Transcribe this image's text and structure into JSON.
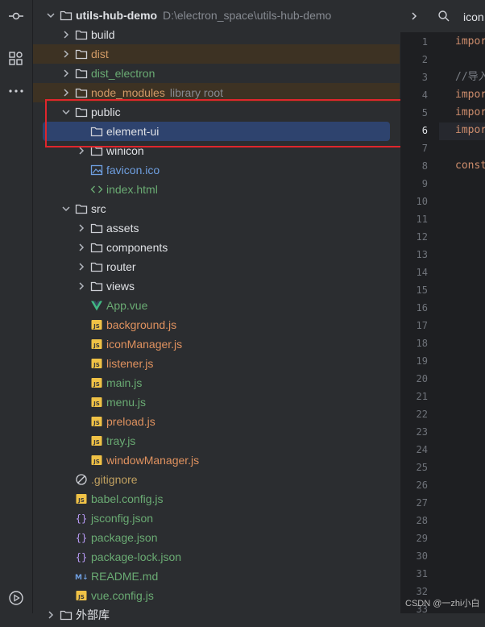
{
  "project": {
    "name": "utils-hub-demo",
    "path": "D:\\electron_space\\utils-hub-demo"
  },
  "tree": [
    {
      "id": "build",
      "label": "build",
      "type": "folder",
      "depth": 1,
      "expanded": false,
      "status": "default"
    },
    {
      "id": "dist",
      "label": "dist",
      "type": "folder",
      "depth": 1,
      "expanded": false,
      "status": "excluded"
    },
    {
      "id": "dist-electron",
      "label": "dist_electron",
      "type": "folder",
      "depth": 1,
      "expanded": false,
      "status": "new"
    },
    {
      "id": "node-modules",
      "label": "node_modules",
      "hint": "library root",
      "type": "folder",
      "depth": 1,
      "expanded": false,
      "status": "excluded"
    },
    {
      "id": "public",
      "label": "public",
      "type": "folder",
      "depth": 1,
      "expanded": true,
      "status": "default"
    },
    {
      "id": "element-ui",
      "label": "element-ui",
      "type": "folder",
      "depth": 2,
      "leaf": true,
      "status": "default",
      "selected": true
    },
    {
      "id": "winicon",
      "label": "winicon",
      "type": "folder",
      "depth": 2,
      "expanded": false,
      "status": "default"
    },
    {
      "id": "favicon",
      "label": "favicon.ico",
      "type": "image",
      "depth": 2,
      "status": "link"
    },
    {
      "id": "index-html",
      "label": "index.html",
      "type": "html",
      "depth": 2,
      "status": "new"
    },
    {
      "id": "src",
      "label": "src",
      "type": "folder",
      "depth": 1,
      "expanded": true,
      "status": "default"
    },
    {
      "id": "assets",
      "label": "assets",
      "type": "folder",
      "depth": 2,
      "expanded": false,
      "status": "default"
    },
    {
      "id": "components",
      "label": "components",
      "type": "folder",
      "depth": 2,
      "expanded": false,
      "status": "default"
    },
    {
      "id": "router",
      "label": "router",
      "type": "folder",
      "depth": 2,
      "expanded": false,
      "status": "default"
    },
    {
      "id": "views",
      "label": "views",
      "type": "folder",
      "depth": 2,
      "expanded": false,
      "status": "default"
    },
    {
      "id": "app-vue",
      "label": "App.vue",
      "type": "vue",
      "depth": 2,
      "status": "new"
    },
    {
      "id": "background-js",
      "label": "background.js",
      "type": "js",
      "depth": 2,
      "status": "modified"
    },
    {
      "id": "iconmanager-js",
      "label": "iconManager.js",
      "type": "js",
      "depth": 2,
      "status": "modified"
    },
    {
      "id": "listener-js",
      "label": "listener.js",
      "type": "js",
      "depth": 2,
      "status": "modified"
    },
    {
      "id": "main-js",
      "label": "main.js",
      "type": "js",
      "depth": 2,
      "status": "new"
    },
    {
      "id": "menu-js",
      "label": "menu.js",
      "type": "js",
      "depth": 2,
      "status": "new"
    },
    {
      "id": "preload-js",
      "label": "preload.js",
      "type": "js",
      "depth": 2,
      "status": "modified"
    },
    {
      "id": "tray-js",
      "label": "tray.js",
      "type": "js",
      "depth": 2,
      "status": "new"
    },
    {
      "id": "windowmanager-js",
      "label": "windowManager.js",
      "type": "js",
      "depth": 2,
      "status": "modified"
    },
    {
      "id": "gitignore",
      "label": ".gitignore",
      "type": "gitignore",
      "depth": 1,
      "status": "git"
    },
    {
      "id": "babel-config",
      "label": "babel.config.js",
      "type": "js",
      "depth": 1,
      "status": "new"
    },
    {
      "id": "jsconfig",
      "label": "jsconfig.json",
      "type": "json",
      "depth": 1,
      "status": "new"
    },
    {
      "id": "package-json",
      "label": "package.json",
      "type": "json",
      "depth": 1,
      "status": "new"
    },
    {
      "id": "package-lock",
      "label": "package-lock.json",
      "type": "json",
      "depth": 1,
      "status": "new"
    },
    {
      "id": "readme",
      "label": "README.md",
      "type": "md",
      "depth": 1,
      "status": "new"
    },
    {
      "id": "vue-config",
      "label": "vue.config.js",
      "type": "js",
      "depth": 1,
      "status": "new"
    },
    {
      "id": "external-libs",
      "label": "外部库",
      "type": "folder",
      "depth": 0,
      "expanded": false,
      "status": "default"
    }
  ],
  "editor": {
    "tab_label": "icon",
    "current_line": 6,
    "line_numbers": [
      "1",
      "2",
      "3",
      "4",
      "5",
      "6",
      "7",
      "8",
      "9",
      "10",
      "11",
      "12",
      "13",
      "14",
      "15",
      "16",
      "17",
      "18",
      "19",
      "20",
      "21",
      "22",
      "23",
      "24",
      "25",
      "26",
      "27",
      "28",
      "29",
      "30",
      "31",
      "32",
      "33"
    ],
    "code": [
      {
        "line": 1,
        "text": "impor",
        "kind": "kw"
      },
      {
        "line": 3,
        "text": "//导入",
        "kind": "cm"
      },
      {
        "line": 4,
        "text": "impor",
        "kind": "kw"
      },
      {
        "line": 5,
        "text": "impor",
        "kind": "kw"
      },
      {
        "line": 6,
        "text": "impor",
        "kind": "kw"
      },
      {
        "line": 8,
        "text": "const",
        "kind": "kw"
      }
    ]
  },
  "icons": {
    "activity": [
      "commit-icon",
      "structure-icon",
      "more-icon",
      "run-icon"
    ],
    "tree_types": {
      "folder": "folder-icon",
      "js": "js-file-icon",
      "json": "json-file-icon",
      "vue": "vue-file-icon",
      "html": "html-file-icon",
      "image": "image-file-icon",
      "md": "markdown-file-icon",
      "gitignore": "gitignore-icon"
    }
  },
  "colors": {
    "selection": "#2e436e",
    "excluded_bg": "#3d3223",
    "highlight_box": "#e0262c",
    "status_new": "#6aab73",
    "status_modified": "#e0925f",
    "status_excluded": "#d19a66"
  },
  "watermark": "CSDN @一zhi小白"
}
